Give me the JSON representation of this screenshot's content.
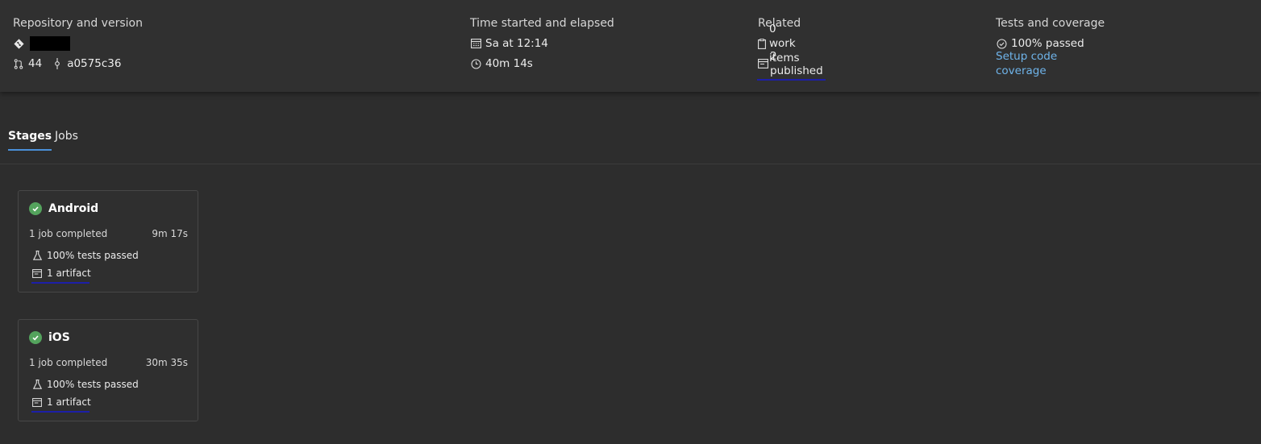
{
  "summary": {
    "repo": {
      "title": "Repository and version",
      "pr_number": "44",
      "commit": "a0575c36"
    },
    "time": {
      "title": "Time started and elapsed",
      "started": "Sa at 12:14",
      "elapsed": "40m 14s"
    },
    "related": {
      "title": "Related",
      "work_items": "0 work items",
      "published": "2 published"
    },
    "tests": {
      "title": "Tests and coverage",
      "passed": "100% passed",
      "coverage_link": "Setup code coverage"
    }
  },
  "tabs": [
    {
      "label": "Stages",
      "active": true
    },
    {
      "label": "Jobs",
      "active": false
    }
  ],
  "stages": [
    {
      "name": "Android",
      "status": "1 job completed",
      "duration": "9m 17s",
      "tests": "100% tests passed",
      "artifacts": "1 artifact"
    },
    {
      "name": "iOS",
      "status": "1 job completed",
      "duration": "30m 35s",
      "tests": "100% tests passed",
      "artifacts": "1 artifact"
    }
  ],
  "colors": {
    "success": "#54a35d",
    "link": "#6fb4ea",
    "tab_indicator": "#4a90d9",
    "annotation_underline": "#1d1fa8"
  }
}
